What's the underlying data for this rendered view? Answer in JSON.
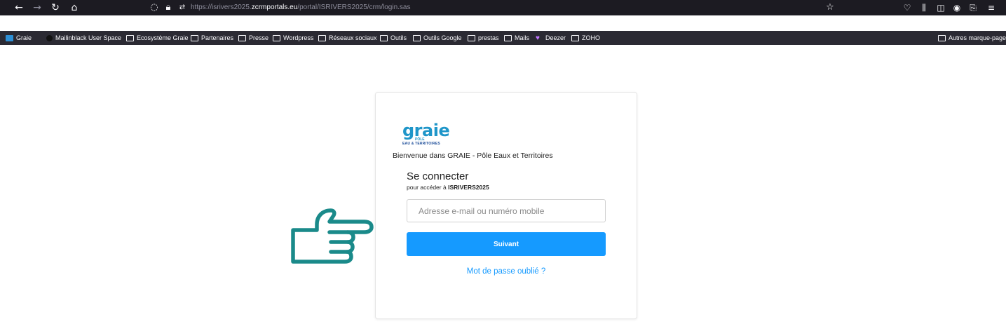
{
  "browser": {
    "url_prefix": "https://isrivers2025.",
    "url_host": "zcrmportals.eu",
    "url_path": "/portal/ISRIVERS2025/crm/login.sas",
    "icons": {
      "back": "back-arrow-icon",
      "forward": "forward-arrow-icon",
      "reload": "reload-icon",
      "home": "home-icon",
      "shield": "shield-icon",
      "lock": "lock-icon",
      "permissions": "permissions-icon",
      "bookmark_star": "star-icon",
      "pocket": "pocket-icon",
      "library": "library-icon",
      "sidebar": "sidebar-icon",
      "account": "account-icon",
      "extensions": "extensions-icon",
      "menu": "menu-icon"
    },
    "bookmarks": [
      {
        "label": "Graie",
        "icon": "favicon"
      },
      {
        "label": "Mailinblack User Space",
        "icon": "mailinblack-icon"
      },
      {
        "label": "Ecosystème Graie",
        "icon": "folder-icon"
      },
      {
        "label": "Partenaires",
        "icon": "folder-icon"
      },
      {
        "label": "Presse",
        "icon": "folder-icon"
      },
      {
        "label": "Wordpress",
        "icon": "folder-icon"
      },
      {
        "label": "Réseaux sociaux",
        "icon": "folder-icon"
      },
      {
        "label": "Outils",
        "icon": "folder-icon"
      },
      {
        "label": "Outils Google",
        "icon": "folder-icon"
      },
      {
        "label": "prestas",
        "icon": "folder-icon"
      },
      {
        "label": "Mails",
        "icon": "folder-icon"
      },
      {
        "label": "Deezer",
        "icon": "heart-icon"
      },
      {
        "label": "ZOHO",
        "icon": "folder-icon"
      }
    ],
    "other_bookmarks": "Autres marque-pages"
  },
  "login": {
    "logo_text": "graie",
    "logo_sub1": "PÔLE",
    "logo_sub2": "EAU & TERRITOIRES",
    "welcome": "Bienvenue dans GRAIE - Pôle Eaux et Territoires",
    "title": "Se connecter",
    "subtitle_prefix": "pour accéder à ",
    "subtitle_portal": "ISRIVERS2025",
    "email_placeholder": "Adresse e-mail ou numéro mobile",
    "email_value": "",
    "next_label": "Suivant",
    "forgot_label": "Mot de passe oublié ?"
  },
  "colors": {
    "primary": "#159aff",
    "logo_blue": "#1f96c9",
    "hand": "#1a8a8a",
    "chrome_bg": "#1c1b22",
    "bookmarks_bg": "#2b2a33"
  }
}
